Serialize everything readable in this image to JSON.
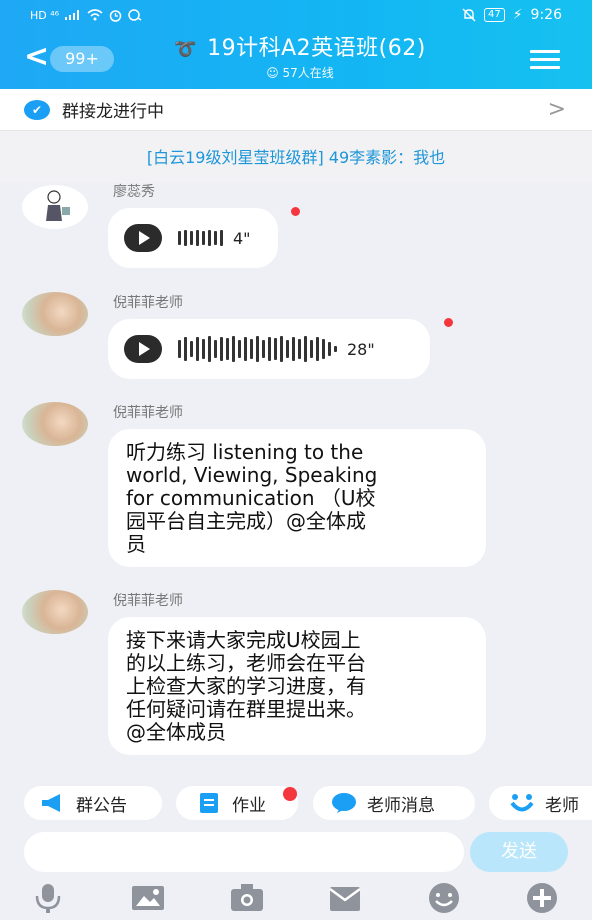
{
  "status": {
    "network": "HD ⁴⁶",
    "battery": "47",
    "time": "9:26"
  },
  "header": {
    "unread_badge": "99+",
    "title": "19计科A2英语班(62)",
    "online": "57人在线"
  },
  "relay": {
    "label": "群接龙进行中"
  },
  "notice": {
    "text": "[白云19级刘星莹班级群] 49李素影：我也"
  },
  "messages": [
    {
      "sender": "廖蕊秀",
      "type": "voice",
      "duration": "4\""
    },
    {
      "sender": "倪菲菲老师",
      "type": "voice",
      "duration": "28\""
    },
    {
      "sender": "倪菲菲老师",
      "type": "text",
      "lines": [
        "听力练习 listening to the",
        "world, Viewing, Speaking",
        "for communication （U校",
        "园平台自主完成）@全体成",
        "员"
      ]
    },
    {
      "sender": "倪菲菲老师",
      "type": "text",
      "lines": [
        "接下来请大家完成U校园上",
        "的以上练习，老师会在平台",
        "上检查大家的学习进度，有",
        "任何疑问请在群里提出来。",
        "@全体成员"
      ]
    }
  ],
  "tabs": [
    {
      "label": "群公告",
      "icon": "megaphone-icon"
    },
    {
      "label": "作业",
      "icon": "document-icon"
    },
    {
      "label": "老师消息",
      "icon": "teacher-icon"
    },
    {
      "label": "老师",
      "icon": "smile-icon"
    }
  ],
  "input": {
    "placeholder": "",
    "send_label": "发送"
  },
  "toolbar": [
    "microphone-icon",
    "image-icon",
    "camera-icon",
    "envelope-icon",
    "emoji-icon",
    "plus-icon"
  ],
  "colors": {
    "accent": "#1fa8f5",
    "unread_dot": "#f5363d",
    "notice_text": "#1f96d8"
  }
}
